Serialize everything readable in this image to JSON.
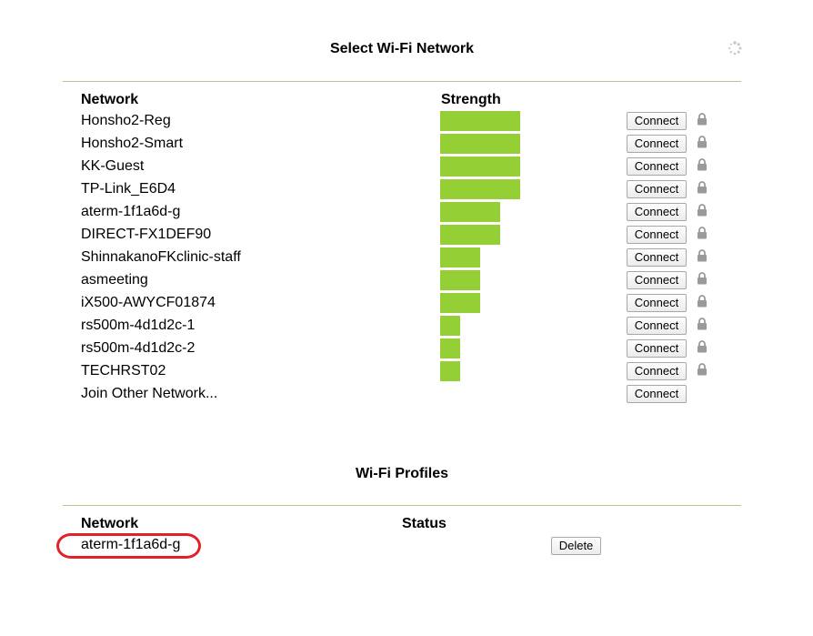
{
  "networks_section": {
    "title": "Select Wi-Fi Network",
    "refresh_icon": "refresh-spinner-icon",
    "col_network": "Network",
    "col_strength": "Strength",
    "connect_label": "Connect",
    "lock_icon": "lock-icon",
    "items": [
      {
        "name": "Honsho2-Reg",
        "strength": 4,
        "secured": true
      },
      {
        "name": "Honsho2-Smart",
        "strength": 4,
        "secured": true
      },
      {
        "name": "KK-Guest",
        "strength": 4,
        "secured": true
      },
      {
        "name": "TP-Link_E6D4",
        "strength": 4,
        "secured": true
      },
      {
        "name": "aterm-1f1a6d-g",
        "strength": 3,
        "secured": true
      },
      {
        "name": "DIRECT-FX1DEF90",
        "strength": 3,
        "secured": true
      },
      {
        "name": "ShinnakanoFKclinic-staff",
        "strength": 2,
        "secured": true
      },
      {
        "name": "asmeeting",
        "strength": 2,
        "secured": true
      },
      {
        "name": "iX500-AWYCF01874",
        "strength": 2,
        "secured": true
      },
      {
        "name": "rs500m-4d1d2c-1",
        "strength": 1,
        "secured": true
      },
      {
        "name": "rs500m-4d1d2c-2",
        "strength": 1,
        "secured": true
      },
      {
        "name": "TECHRST02",
        "strength": 1,
        "secured": true
      },
      {
        "name": "Join Other Network...",
        "strength": 0,
        "secured": false
      }
    ],
    "strength_max": 4,
    "bar_color": "#95cf36"
  },
  "profiles_section": {
    "title": "Wi-Fi Profiles",
    "col_network": "Network",
    "col_status": "Status",
    "delete_label": "Delete",
    "items": [
      {
        "name": "aterm-1f1a6d-g",
        "status": ""
      }
    ],
    "highlight_color": "#e0202a"
  }
}
